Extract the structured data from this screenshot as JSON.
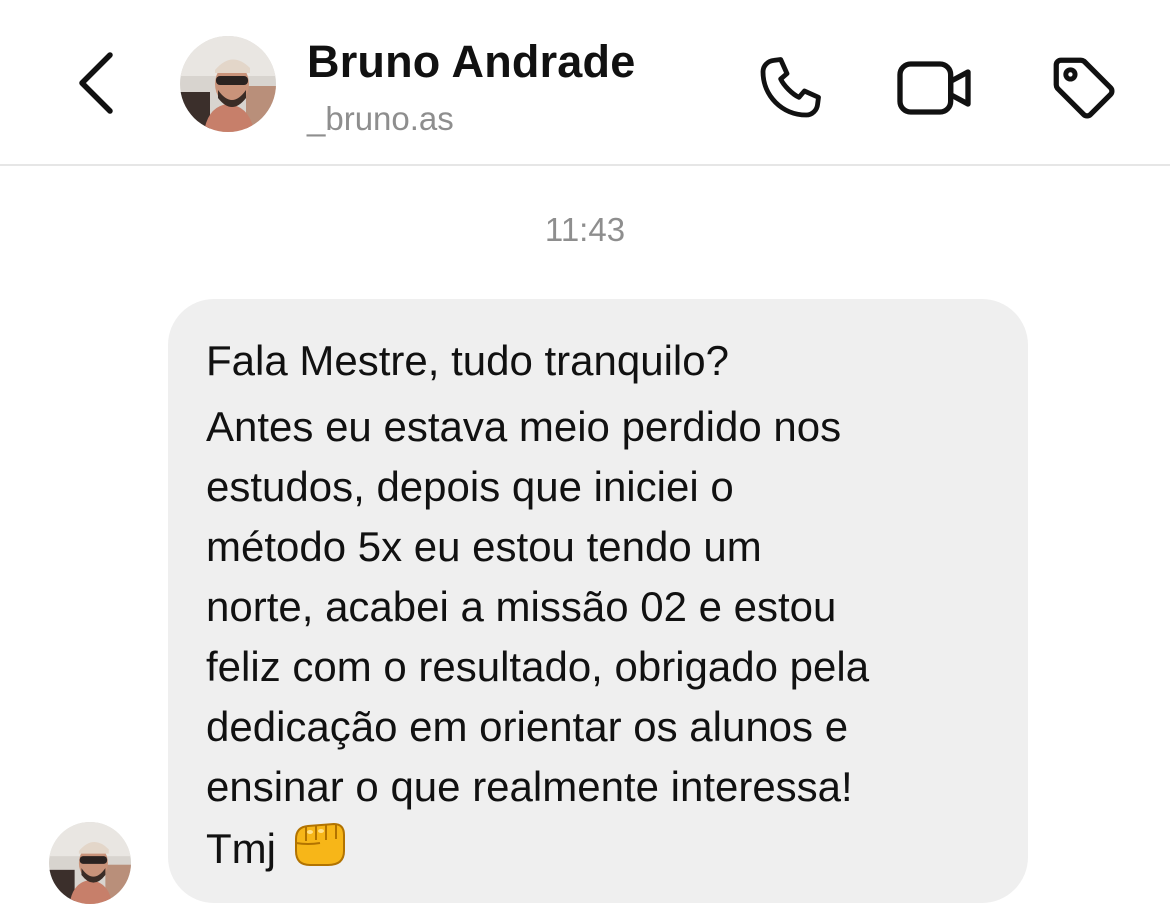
{
  "header": {
    "contact_name": "Bruno Andrade",
    "contact_handle": "_bruno.as",
    "icons": {
      "back": "chevron-left-icon",
      "call": "phone-icon",
      "video": "video-camera-icon",
      "label": "tag-icon"
    }
  },
  "conversation": {
    "timestamp": "11:43",
    "message": {
      "lines": [
        "Fala Mestre, tudo tranquilo?",
        "Antes eu estava meio perdido nos",
        "estudos, depois que iniciei o",
        "método 5x eu estou tendo um",
        "norte, acabei a missão 02 e estou",
        "feliz com o resultado, obrigado pela",
        "dedicação em orientar os alunos e",
        "ensinar o que realmente interessa!",
        "Tmj"
      ],
      "emoji": "fist-bump-emoji"
    }
  },
  "colors": {
    "bubble_bg": "#efefef",
    "text": "#111111",
    "secondary_text": "#8e8e8e",
    "divider": "#e6e6e6"
  }
}
